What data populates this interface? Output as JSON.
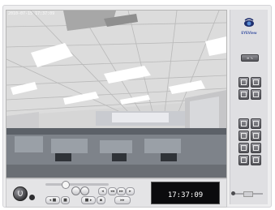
{
  "video": {
    "overlay_timestamp": "2010-07-15 17:37:09",
    "scene": "office-ceiling-camera-view"
  },
  "controls": {
    "clock": "17:37:09",
    "icons": [
      "power-icon",
      "record-dot-icon",
      "volume-slider",
      "play-icon",
      "pause-icon",
      "stop-icon",
      "prev-icon",
      "next-icon",
      "rewind-icon",
      "forward-icon"
    ]
  },
  "panel": {
    "logo_text": "EYEView",
    "pill_label": "≡ ∿",
    "tool_icons": [
      "view-single-icon",
      "view-quad-icon",
      "zoom-in-icon",
      "zoom-out-icon",
      "pen-icon",
      "search-icon",
      "key-icon",
      "grid-icon",
      "rotate-icon",
      "person-icon",
      "list-icon",
      "settings-icon"
    ]
  },
  "colors": {
    "frame_bg": "#eeeeef",
    "panel_bg": "#dfdfe2",
    "clock_bg": "#0b0b0d",
    "logo_blue": "#4a5fa8"
  }
}
